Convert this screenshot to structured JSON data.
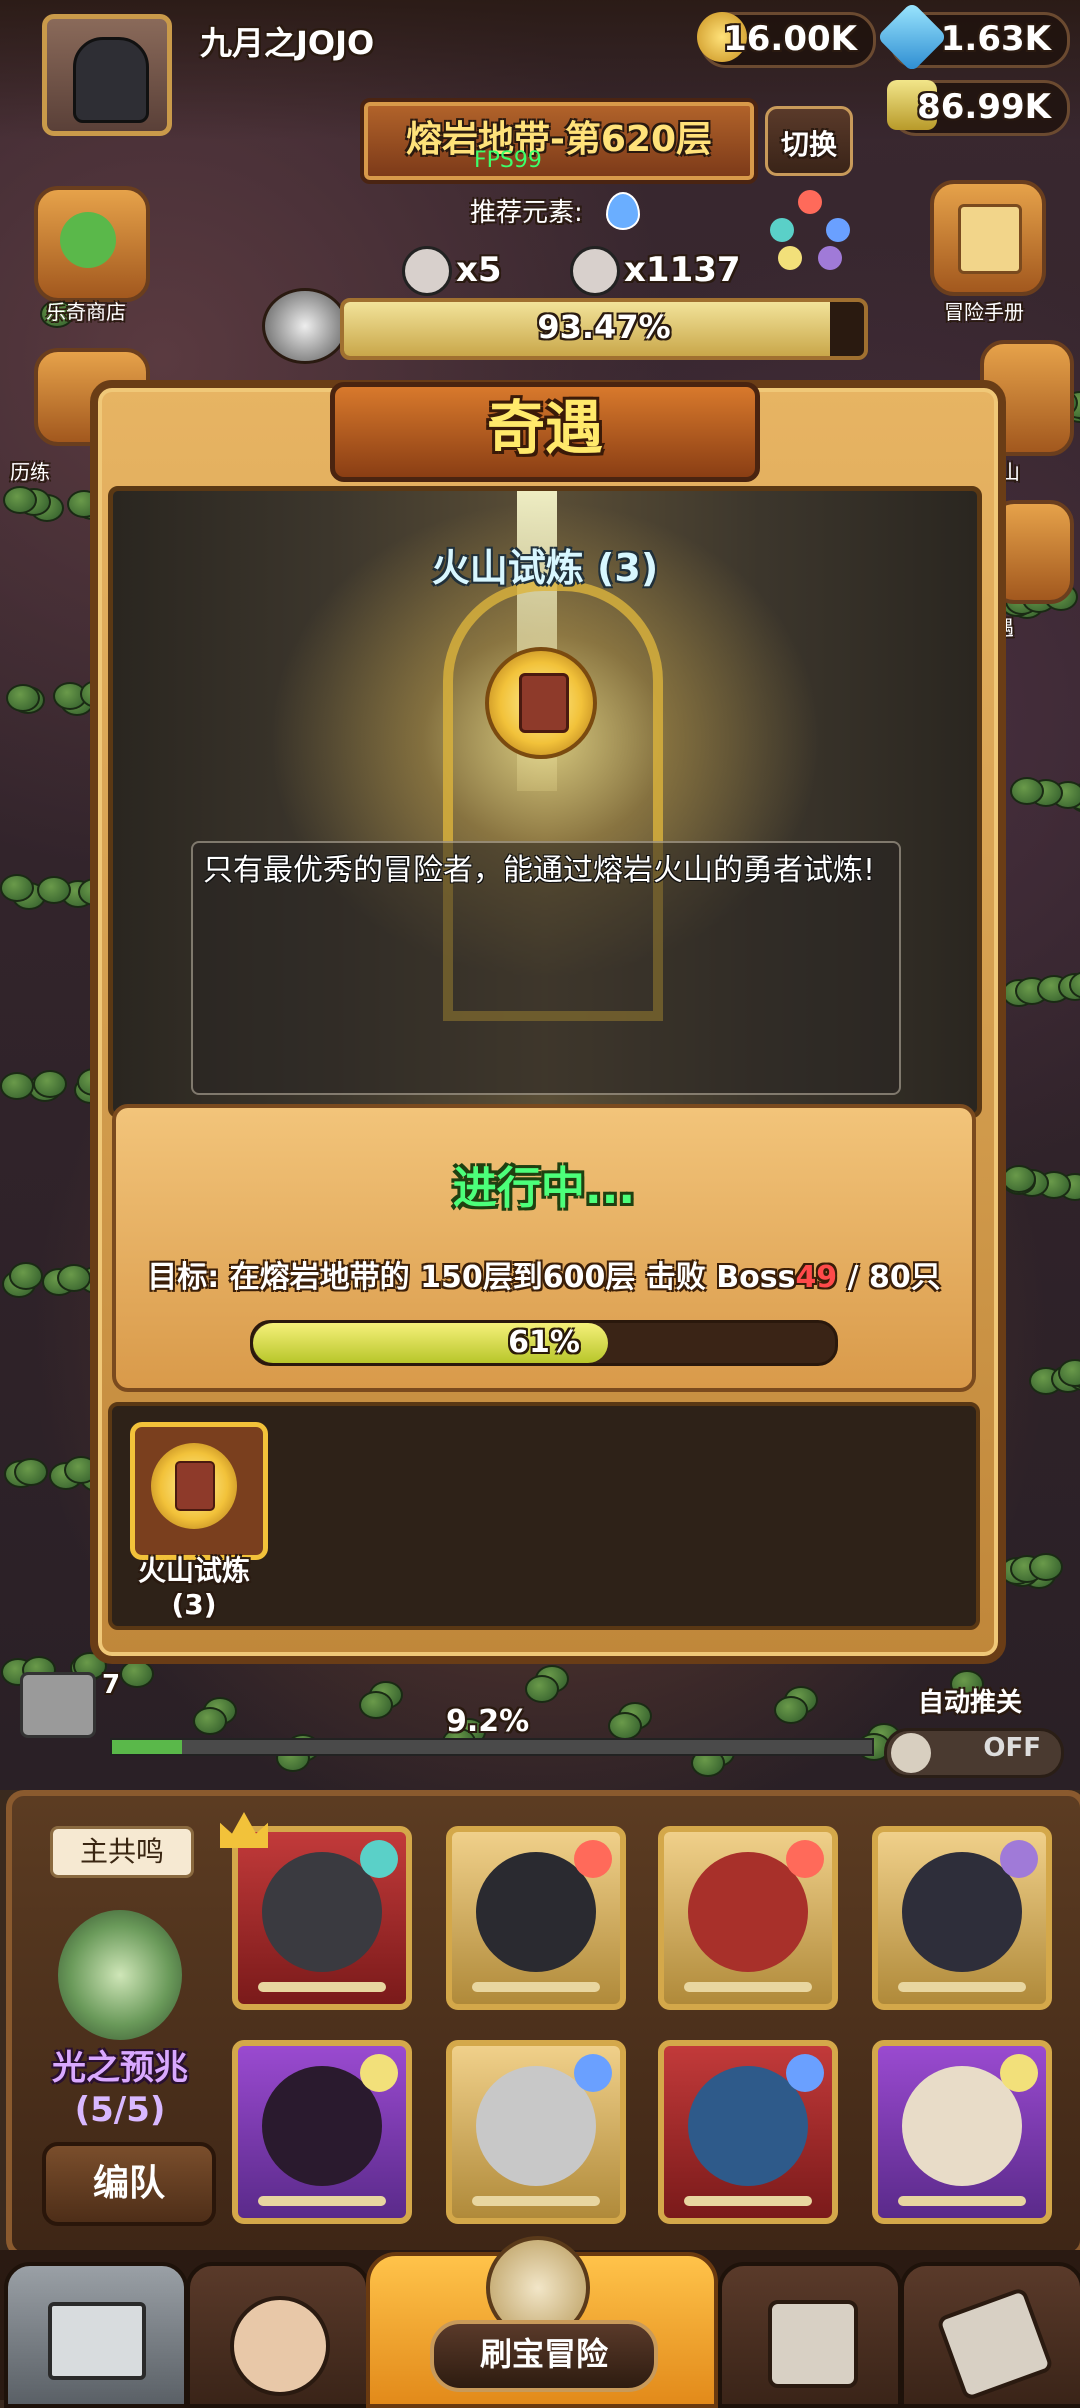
{
  "player": {
    "name": "九月之JOJO"
  },
  "resources": {
    "gold": "16.00K",
    "gems": "1.63K",
    "potion": "86.99K"
  },
  "stage": {
    "floor_title": "熔岩地带-第620层",
    "fps": "FPS99",
    "switch_label": "切换",
    "recommend_label": "推荐元素:",
    "boss_kills": "x5",
    "enemy_kills": "x1137",
    "boss_progress_text": "93.47%",
    "boss_progress": 0.9347
  },
  "side_buttons": {
    "shop": "乐奇商店",
    "history": "历练",
    "manual": "冒险手册",
    "volcano": "火山",
    "encounter": "遇"
  },
  "dialog": {
    "title": "奇遇",
    "scene_title": "火山试炼 (3)",
    "description": "只有最优秀的冒险者，能通过熔岩火山的勇者试炼!",
    "status": "进行中...",
    "goal_prefix": "目标: 在熔岩地带的 150层到600层 击败 Boss",
    "goal_current": "49",
    "goal_total": " / 80只",
    "progress_text": "61%",
    "progress": 0.61,
    "reward_label_1": "火山试炼",
    "reward_label_2": "(3)"
  },
  "hud": {
    "chest_count": "7",
    "stage_percent": "9.2%",
    "stage_progress": 0.092,
    "auto_label": "自动推关",
    "auto_state": "OFF"
  },
  "team": {
    "resonance_tag": "主共鸣",
    "emblem_name": "光之预兆",
    "emblem_count": "(5/5)",
    "formation_button": "编队"
  },
  "nav": {
    "active_label": "刷宝冒险"
  }
}
